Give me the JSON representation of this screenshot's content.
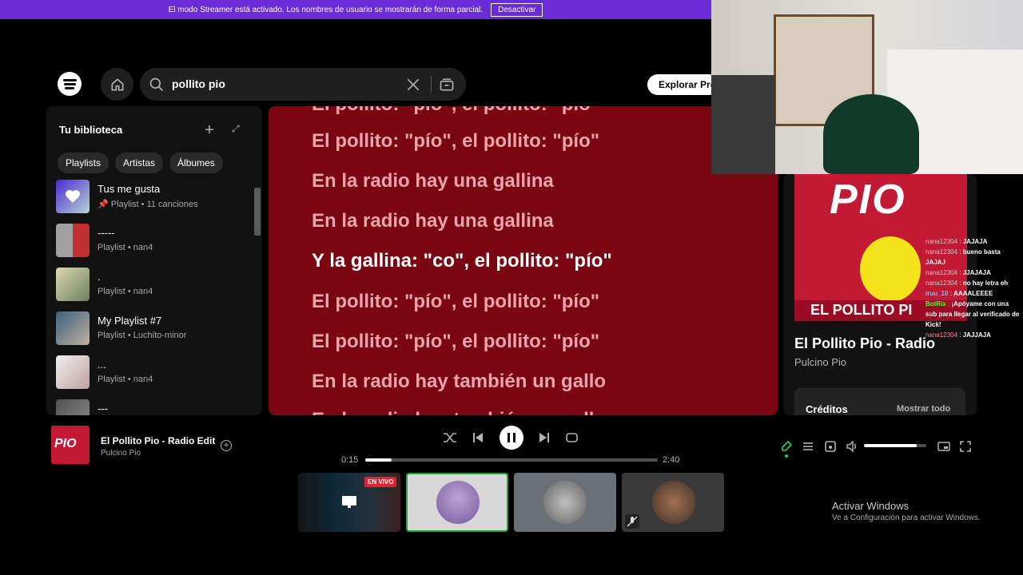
{
  "banner": {
    "text": "El modo Streamer está activado. Los nombres de usuario se mostrarán de forma parcial.",
    "button": "Desactivar"
  },
  "search": {
    "value": "pollito pio"
  },
  "header": {
    "explore_label": "Explorar Pre"
  },
  "library": {
    "title": "Tu biblioteca",
    "chips": [
      "Playlists",
      "Artistas",
      "Álbumes"
    ],
    "items": [
      {
        "name": "Tus me gusta",
        "meta": "Playlist • 11 canciones"
      },
      {
        "name": "-----",
        "meta": "Playlist • nan4"
      },
      {
        "name": ".",
        "meta": "Playlist • nan4"
      },
      {
        "name": "My Playlist #7",
        "meta": "Playlist • Luchito-minor"
      },
      {
        "name": "...",
        "meta": "Playlist • nan4"
      },
      {
        "name": "---",
        "meta": ""
      }
    ]
  },
  "lyrics": {
    "lines": [
      "El pollito: \"pío\", el pollito: \"pío\"",
      "El pollito: \"pío\", el pollito: \"pío\"",
      "En la radio hay una gallina",
      "En la radio hay una gallina",
      "Y la gallina: \"co\", el pollito: \"pío\"",
      "El pollito: \"pío\", el pollito: \"pío\"",
      "El pollito: \"pío\", el pollito: \"pío\"",
      "En la radio hay también un gallo",
      "En la radio hay también un gallo"
    ],
    "active_index": 4
  },
  "now_playing": {
    "title": "El Pollito Pio - Radio Edit",
    "artist": "Pulcino Pio",
    "elapsed": "0:15",
    "duration": "2:40",
    "progress": 0.09,
    "volume": 0.85
  },
  "side_panel": {
    "cover_word": "PIO",
    "cover_sub": "EL POLLITO PI",
    "title": "El Pollito Pio - Radio",
    "artist": "Pulcino Pio",
    "credits": "Créditos",
    "show_all": "Mostrar todo"
  },
  "art": {
    "small_word": "PIO"
  },
  "participants": {
    "live_label": "EN VIVO"
  },
  "chat": [
    {
      "user": "nana12304",
      "msg": "JAJAJA"
    },
    {
      "user": "nana12304",
      "msg": "bueno basta JAJAJ"
    },
    {
      "user": "nana12304",
      "msg": "JJAJAJA"
    },
    {
      "user": "nana12304",
      "msg": "no hay letra eh"
    },
    {
      "user": "iruu_10",
      "msg": "AAAALEEEE"
    },
    {
      "user": "BotRix",
      "msg": "¡Apóyame con una sub para llegar al verificado de Kick!"
    },
    {
      "user": "nana12304",
      "msg": "JAJJAJA"
    }
  ],
  "watermark": {
    "title": "Activar Windows",
    "subtitle": "Ve a Configuración para activar Windows."
  },
  "colors": {
    "accent": "#1ed760",
    "banner": "#6b2bd9",
    "lyrics_bg": "#7a0612"
  }
}
